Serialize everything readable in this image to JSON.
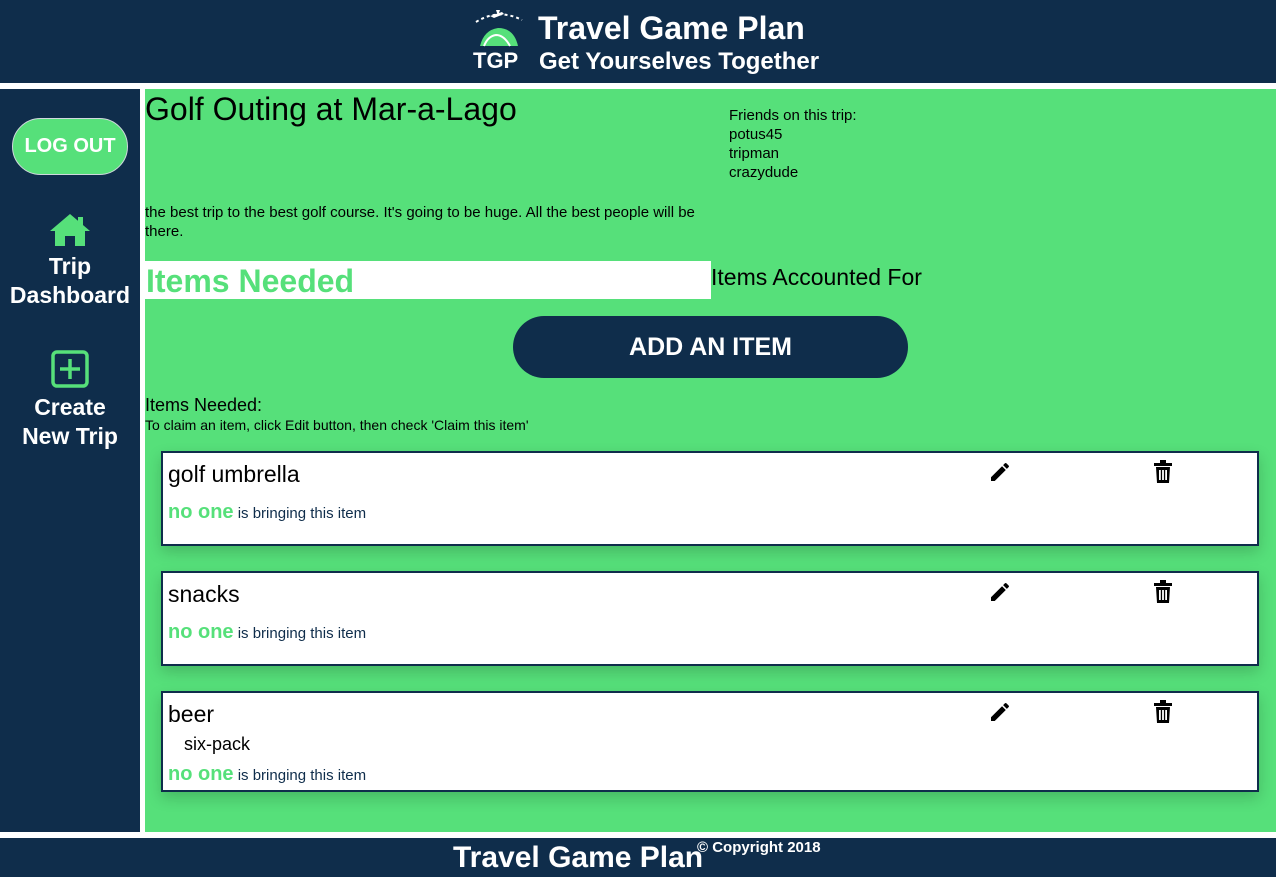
{
  "header": {
    "logo_text": "TGP",
    "title": "Travel Game Plan",
    "subtitle": "Get Yourselves Together"
  },
  "sidebar": {
    "logout_label": "LOG OUT",
    "items": [
      {
        "label_line1": "Trip",
        "label_line2": "Dashboard",
        "icon": "home-icon"
      },
      {
        "label_line1": "Create",
        "label_line2": "New Trip",
        "icon": "plus-square-icon"
      }
    ]
  },
  "trip": {
    "title": "Golf Outing at Mar-a-Lago",
    "friends_label": "Friends on this trip:",
    "friends": [
      "potus45",
      "tripman",
      "crazydude"
    ],
    "description": "the best trip to the best golf course. It's going to be huge. All the best people will be there."
  },
  "tabs": {
    "needed": "Items Needed",
    "accounted": "Items Accounted For"
  },
  "add_item_label": "ADD AN ITEM",
  "needed_heading": "Items Needed:",
  "needed_hint": "To claim an item, click Edit button, then check 'Claim this item'",
  "items": [
    {
      "name": "golf umbrella",
      "note": "",
      "who": "no one",
      "status_suffix": " is bringing this item"
    },
    {
      "name": "snacks",
      "note": "",
      "who": "no one",
      "status_suffix": " is bringing this item"
    },
    {
      "name": "beer",
      "note": "six-pack",
      "who": "no one",
      "status_suffix": " is bringing this item"
    }
  ],
  "footer": {
    "title": "Travel Game Plan",
    "copyright": "© Copyright 2018"
  },
  "colors": {
    "navy": "#0f2d4b",
    "green": "#56e07a",
    "white": "#ffffff"
  }
}
